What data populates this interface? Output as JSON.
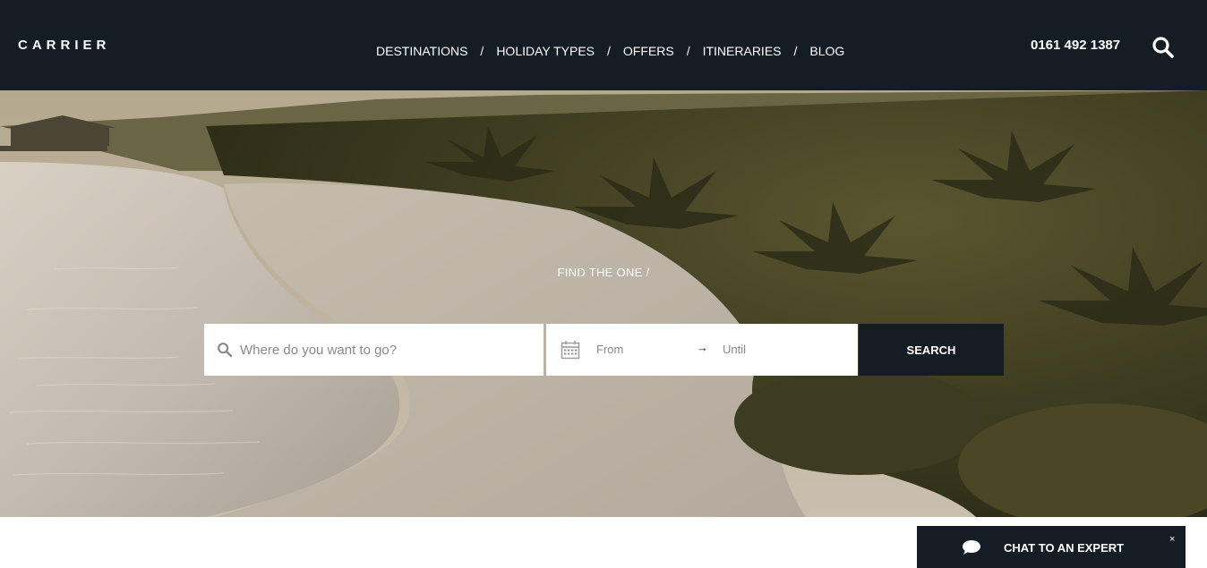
{
  "header": {
    "logo": "CARRIER",
    "nav": [
      "DESTINATIONS",
      "HOLIDAY TYPES",
      "OFFERS",
      "ITINERARIES",
      "BLOG"
    ],
    "nav_separator": "/",
    "phone": "0161 492 1387",
    "search_icon": "search-icon"
  },
  "hero": {
    "eyebrow": "FIND THE ONE /",
    "search": {
      "destination_placeholder": "Where do you want to go?",
      "from_label": "From",
      "arrow": "→",
      "until_label": "Until",
      "button_label": "SEARCH"
    }
  },
  "chat": {
    "label": "CHAT TO AN EXPERT",
    "close": "×",
    "icon": "chat-bubble-icon"
  },
  "colors": {
    "header_bg": "#141c24",
    "accent": "#141c24",
    "white": "#ffffff"
  }
}
